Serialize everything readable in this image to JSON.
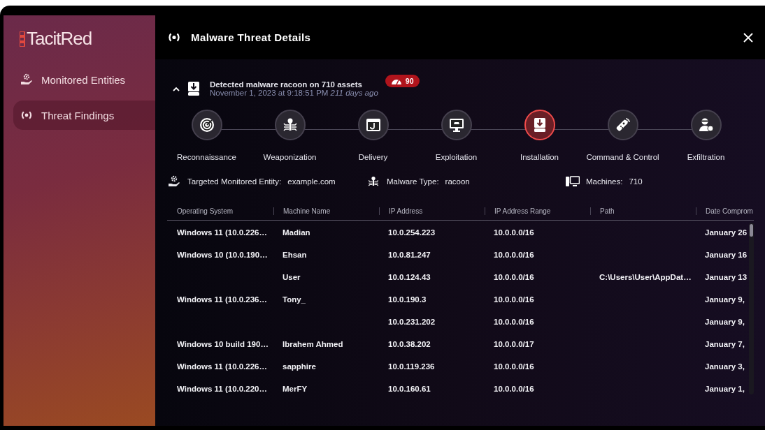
{
  "sidebar": {
    "logo": "TacitRed",
    "items": [
      {
        "label": "Monitored Entities",
        "selected": false
      },
      {
        "label": "Threat Findings",
        "selected": true
      }
    ]
  },
  "panel": {
    "title": "Malware Threat Details"
  },
  "alert": {
    "expanded": true,
    "title": "Detected malware racoon on 710 assets",
    "timestamp": "November 1, 2023 at 9:18:51 PM",
    "age": "211 days ago",
    "score": "90"
  },
  "stages": [
    {
      "label": "Reconnaissance",
      "selected": false
    },
    {
      "label": "Weaponization",
      "selected": false
    },
    {
      "label": "Delivery",
      "selected": false
    },
    {
      "label": "Exploitation",
      "selected": false
    },
    {
      "label": "Installation",
      "selected": true
    },
    {
      "label": "Command & Control",
      "selected": false
    },
    {
      "label": "Exfiltration",
      "selected": false
    }
  ],
  "info": [
    {
      "label": "Targeted Monitored Entity:",
      "value": "example.com"
    },
    {
      "label": "Malware Type:",
      "value": "racoon"
    },
    {
      "label": "Machines:",
      "value": "710"
    }
  ],
  "table": {
    "columns": [
      "Operating System",
      "Machine Name",
      "IP Address",
      "IP Address Range",
      "Path",
      "Date Comprom"
    ],
    "rows": [
      [
        "Windows 11 (10.0.226…",
        "Madian",
        "10.0.254.223",
        "10.0.0.0/16",
        "",
        "January 26"
      ],
      [
        "Windows 10 (10.0.190…",
        "Ehsan",
        "10.0.81.247",
        "10.0.0.0/16",
        "",
        "January 16"
      ],
      [
        "",
        "User",
        "10.0.124.43",
        "10.0.0.0/16",
        "C:\\Users\\User\\AppDat…",
        "January 13"
      ],
      [
        "Windows 11 (10.0.236…",
        "Tony_",
        "10.0.190.3",
        "10.0.0.0/16",
        "",
        "January 9,"
      ],
      [
        "",
        "",
        "10.0.231.202",
        "10.0.0.0/16",
        "",
        "January 9,"
      ],
      [
        "Windows 10 build 190…",
        "Ibrahem Ahmed",
        "10.0.38.202",
        "10.0.0.0/17",
        "",
        "January 7,"
      ],
      [
        "Windows 11 (10.0.226…",
        "sapphire",
        "10.0.119.236",
        "10.0.0.0/16",
        "",
        "January 3,"
      ],
      [
        "Windows 11 (10.0.220…",
        "MerFY",
        "10.0.160.61",
        "10.0.0.0/16",
        "",
        "January 1,"
      ]
    ]
  }
}
